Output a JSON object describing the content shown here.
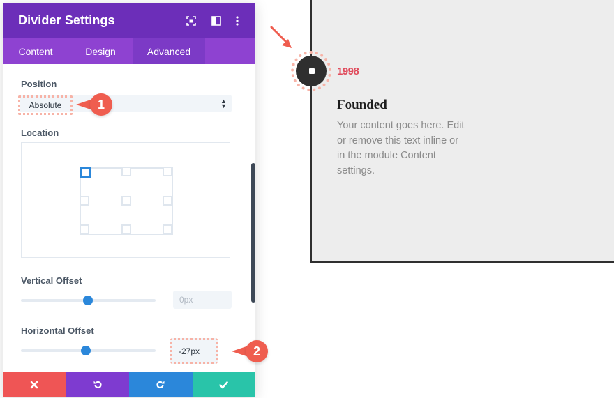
{
  "panel": {
    "title": "Divider Settings",
    "header_icons": [
      "expand-icon",
      "split-view-icon",
      "more-options-icon"
    ],
    "colors": {
      "header": "#6c2eb9",
      "tabs": "#8e42d1",
      "active_tab": "#7c3ac6"
    }
  },
  "tabs": [
    {
      "label": "Content",
      "active": false
    },
    {
      "label": "Design",
      "active": false
    },
    {
      "label": "Advanced",
      "active": true
    }
  ],
  "position": {
    "label": "Position",
    "value": "Absolute"
  },
  "location": {
    "label": "Location",
    "selected": "top-left"
  },
  "vertical_offset": {
    "label": "Vertical Offset",
    "placeholder": "0px",
    "slider_fraction": 0.5
  },
  "horizontal_offset": {
    "label": "Horizontal Offset",
    "value": "-27px",
    "slider_fraction": 0.48
  },
  "callouts": {
    "one": "1",
    "two": "2"
  },
  "footer": {
    "buttons": [
      {
        "name": "cancel",
        "icon": "close-icon",
        "color": "#ef5555"
      },
      {
        "name": "undo",
        "icon": "undo-icon",
        "color": "#7e3bd0"
      },
      {
        "name": "redo",
        "icon": "redo-icon",
        "color": "#2b87da"
      },
      {
        "name": "save",
        "icon": "check-icon",
        "color": "#29c4a9"
      }
    ]
  },
  "preview": {
    "year": "1998",
    "heading": "Founded",
    "body_lines": [
      "Your content goes here. Edit",
      "or remove this text inline or",
      "in the module Content",
      "settings."
    ]
  }
}
